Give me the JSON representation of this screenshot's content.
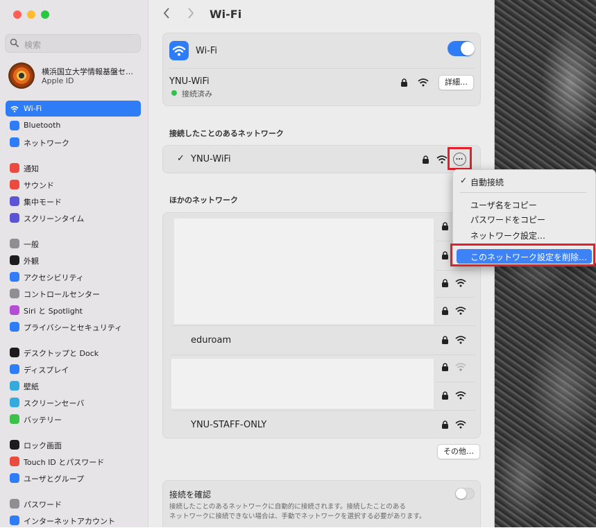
{
  "sidebar": {
    "search_placeholder": "検索",
    "account": {
      "name": "横浜国立大学情報基盤セン…",
      "sub": "Apple ID"
    },
    "items": [
      {
        "label": "Wi-Fi",
        "icon": "wifi-icon",
        "color": "#2f7df6"
      },
      {
        "label": "Bluetooth",
        "icon": "bluetooth-icon",
        "color": "#2f7df6"
      },
      {
        "label": "ネットワーク",
        "icon": "globe-icon",
        "color": "#2f7df6"
      },
      {
        "label": "通知",
        "icon": "bell-icon",
        "color": "#eb4b3f"
      },
      {
        "label": "サウンド",
        "icon": "speaker-icon",
        "color": "#eb4b3f"
      },
      {
        "label": "集中モード",
        "icon": "moon-icon",
        "color": "#5b55d6"
      },
      {
        "label": "スクリーンタイム",
        "icon": "hourglass-icon",
        "color": "#5b55d6"
      },
      {
        "label": "一般",
        "icon": "gear-icon",
        "color": "#8e8e93"
      },
      {
        "label": "外観",
        "icon": "appearance-icon",
        "color": "#1c1c1e"
      },
      {
        "label": "アクセシビリティ",
        "icon": "accessibility-icon",
        "color": "#2f7df6"
      },
      {
        "label": "コントロールセンター",
        "icon": "control-center-icon",
        "color": "#8e8e93"
      },
      {
        "label": "Siri と Spotlight",
        "icon": "siri-icon",
        "color": "#b44cd6"
      },
      {
        "label": "プライバシーとセキュリティ",
        "icon": "hand-icon",
        "color": "#2f7df6"
      },
      {
        "label": "デスクトップと Dock",
        "icon": "dock-icon",
        "color": "#1c1c1e"
      },
      {
        "label": "ディスプレイ",
        "icon": "display-icon",
        "color": "#2f7df6"
      },
      {
        "label": "壁紙",
        "icon": "wallpaper-icon",
        "color": "#35aadc"
      },
      {
        "label": "スクリーンセーバ",
        "icon": "screensaver-icon",
        "color": "#35aadc"
      },
      {
        "label": "バッテリー",
        "icon": "battery-icon",
        "color": "#3cc24a"
      },
      {
        "label": "ロック画面",
        "icon": "lock-screen-icon",
        "color": "#1c1c1e"
      },
      {
        "label": "Touch ID とパスワード",
        "icon": "fingerprint-icon",
        "color": "#eb4b3f"
      },
      {
        "label": "ユーザとグループ",
        "icon": "users-icon",
        "color": "#2f7df6"
      },
      {
        "label": "パスワード",
        "icon": "key-icon",
        "color": "#8e8e93"
      },
      {
        "label": "インターネットアカウント",
        "icon": "at-icon",
        "color": "#2f7df6"
      }
    ]
  },
  "header": {
    "title": "Wi-Fi"
  },
  "wifi_card": {
    "label": "Wi-Fi",
    "toggle_on": true,
    "current_network": "YNU-WiFi",
    "status": "接続済み",
    "details_button": "詳細…"
  },
  "known": {
    "title": "接続したことのあるネットワーク",
    "network": "YNU-WiFi",
    "checkmark": "✓"
  },
  "other": {
    "title": "ほかのネットワーク",
    "named": [
      "eduroam",
      "YNU-STAFF-ONLY"
    ],
    "more_button": "その他…"
  },
  "confirm": {
    "title": "接続を確認",
    "desc1": "接続したことのあるネットワークに自動的に接続されます。接続したことのある",
    "desc2": "ネットワークに接続できない場合は、手動でネットワークを選択する必要があります。"
  },
  "menu": {
    "auto_join": "自動接続",
    "copy_user": "ユーザ名をコピー",
    "copy_password": "パスワードをコピー",
    "network_settings": "ネットワーク設定…",
    "forget": "このネットワーク設定を削除…"
  },
  "colors": {
    "accent": "#2f7df6",
    "connected": "#32c24a",
    "highlight": "#e0202a"
  }
}
